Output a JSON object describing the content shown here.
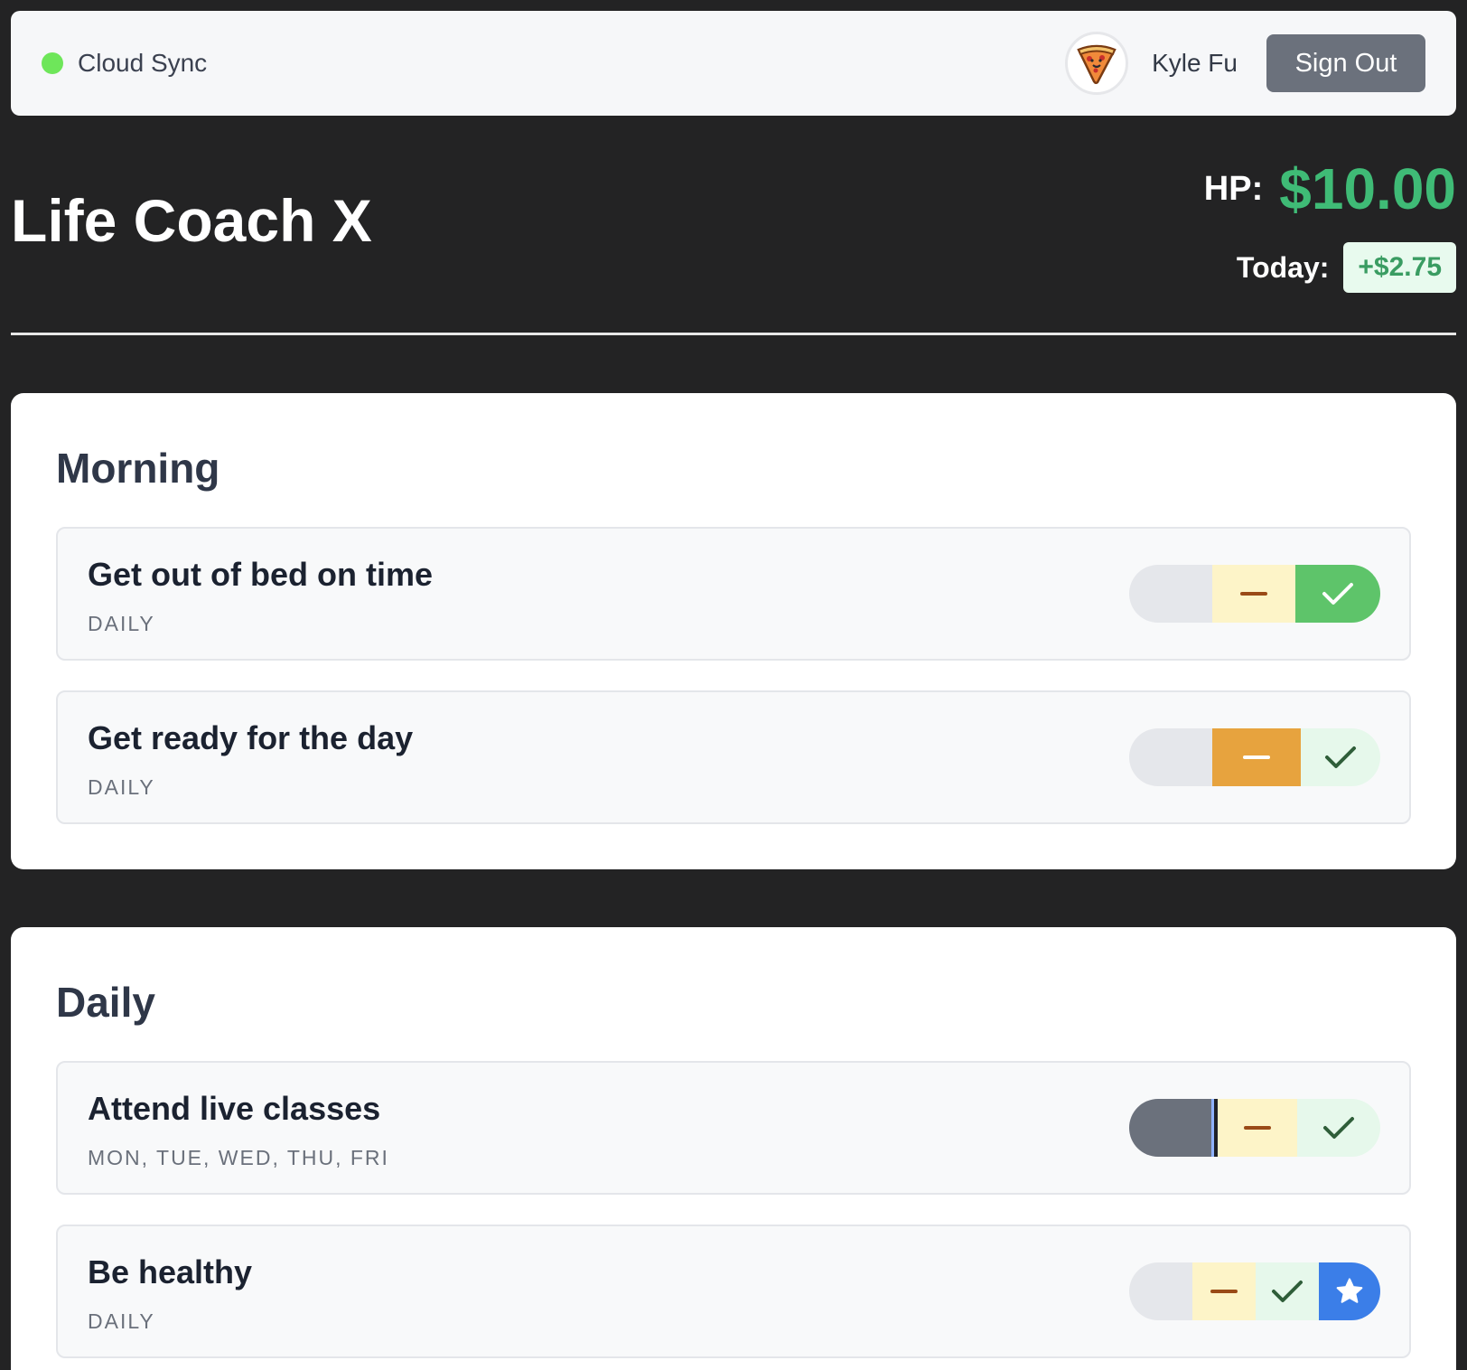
{
  "topbar": {
    "sync_label": "Cloud Sync",
    "sync_color": "#6ee65a",
    "user_name": "Kyle Fu",
    "avatar_icon": "pizza-icon",
    "sign_out_label": "Sign Out"
  },
  "header": {
    "app_title": "Life Coach X",
    "hp_label": "HP:",
    "hp_value": "$10.00",
    "today_label": "Today:",
    "today_value": "+$2.75"
  },
  "sections": [
    {
      "title": "Morning",
      "habits": [
        {
          "name": "Get out of bed on time",
          "frequency": "DAILY",
          "state": "done"
        },
        {
          "name": "Get ready for the day",
          "frequency": "DAILY",
          "state": "partial"
        }
      ]
    },
    {
      "title": "Daily",
      "habits": [
        {
          "name": "Attend live classes",
          "frequency": "MON, TUE, WED, THU, FRI",
          "state": "skip"
        },
        {
          "name": "Be healthy",
          "frequency": "DAILY",
          "state": "star"
        }
      ]
    }
  ],
  "colors": {
    "accent_green": "#3fbb76",
    "done_green": "#5ec46a",
    "partial_orange": "#e7a33e",
    "star_blue": "#3b7ee8",
    "skip_gray": "#6b717c"
  }
}
